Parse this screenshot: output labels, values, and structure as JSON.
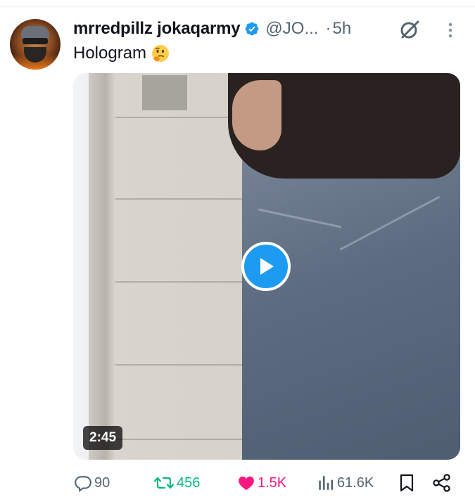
{
  "author": {
    "display_name": "mrredpillz jokaqarmy",
    "handle": "@JO...",
    "time_separator": "·",
    "time": "5h",
    "avatar_icon": "avatar",
    "verified_icon": "verified-badge-icon"
  },
  "tweet": {
    "text": "Hologram",
    "emoji": "thinking-face-emoji"
  },
  "media": {
    "type": "video",
    "duration": "2:45",
    "play_icon": "play-icon"
  },
  "actions": {
    "replies": "90",
    "retweets": "456",
    "likes": "1.5K",
    "views": "61.6K"
  },
  "colors": {
    "accent": "#1d9bf0",
    "retweet": "#00ba7c",
    "like": "#f91880",
    "muted": "#536471",
    "text": "#0f1419"
  }
}
